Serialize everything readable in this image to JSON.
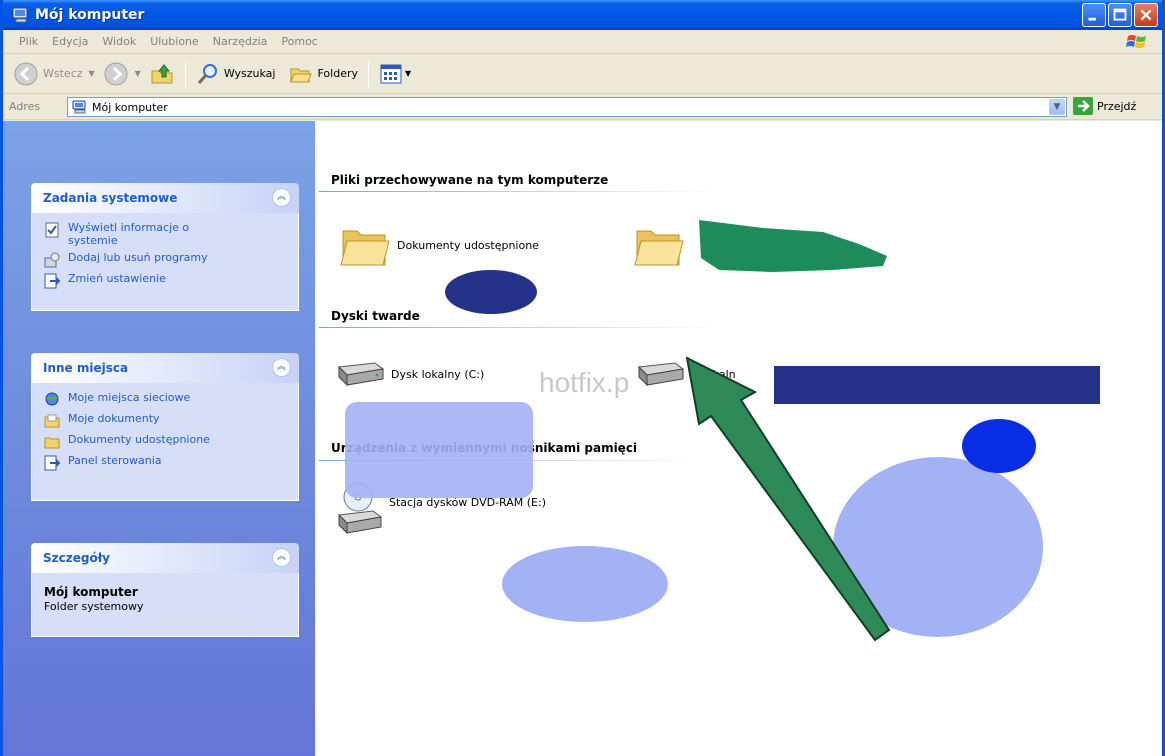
{
  "window": {
    "title": "Mój komputer"
  },
  "menubar": {
    "items": [
      "Plik",
      "Edycja",
      "Widok",
      "Ulubione",
      "Narzędzia",
      "Pomoc"
    ]
  },
  "toolbar": {
    "back_label": "Wstecz",
    "search_label": "Wyszukaj",
    "folders_label": "Foldery"
  },
  "address": {
    "label": "Adres",
    "value": "Mój komputer",
    "go_label": "Przejdź"
  },
  "sidebar": {
    "system_tasks": {
      "title": "Zadania systemowe",
      "items": [
        {
          "label": "Wyświetl informacje o systemie",
          "icon": "system-info-icon"
        },
        {
          "label": "Dodaj lub usuń programy",
          "icon": "add-remove-programs-icon"
        },
        {
          "label": "Zmień ustawienie",
          "icon": "change-setting-icon"
        }
      ]
    },
    "other_places": {
      "title": "Inne miejsca",
      "items": [
        {
          "label": "Moje miejsca sieciowe",
          "icon": "network-places-icon"
        },
        {
          "label": "Moje dokumenty",
          "icon": "my-documents-icon"
        },
        {
          "label": "Dokumenty udostępnione",
          "icon": "shared-documents-icon"
        },
        {
          "label": "Panel sterowania",
          "icon": "control-panel-icon"
        }
      ]
    },
    "details": {
      "title": "Szczegóły",
      "name": "Mój komputer",
      "type": "Folder systemowy"
    }
  },
  "main": {
    "groups": [
      {
        "title": "Pliki przechowywane na tym komputerze"
      },
      {
        "title": "Dyski twarde"
      },
      {
        "title": "Urządzenia z wymiennymi nośnikami pamięci"
      }
    ],
    "items": {
      "shared_docs": "Dokumenty udostępnione",
      "disk_c": "Dysk lokalny (C:)",
      "disk_d_partial": "k lokaln",
      "dvd": "Stacja dysków DVD-RAM (E:)"
    },
    "watermark": "hotfix.p"
  },
  "colors": {
    "title_bar": "#0058e6",
    "sidebar_top": "#7ba2e7",
    "sidebar_bottom": "#6375d6",
    "panel_title": "#215dc6",
    "arrow": "#2e8b57",
    "redact_green": "#1e8c5a",
    "redact_navy": "#25328a",
    "blob_light": "#a3b1f5",
    "blob_blue": "#0a2ee6"
  }
}
